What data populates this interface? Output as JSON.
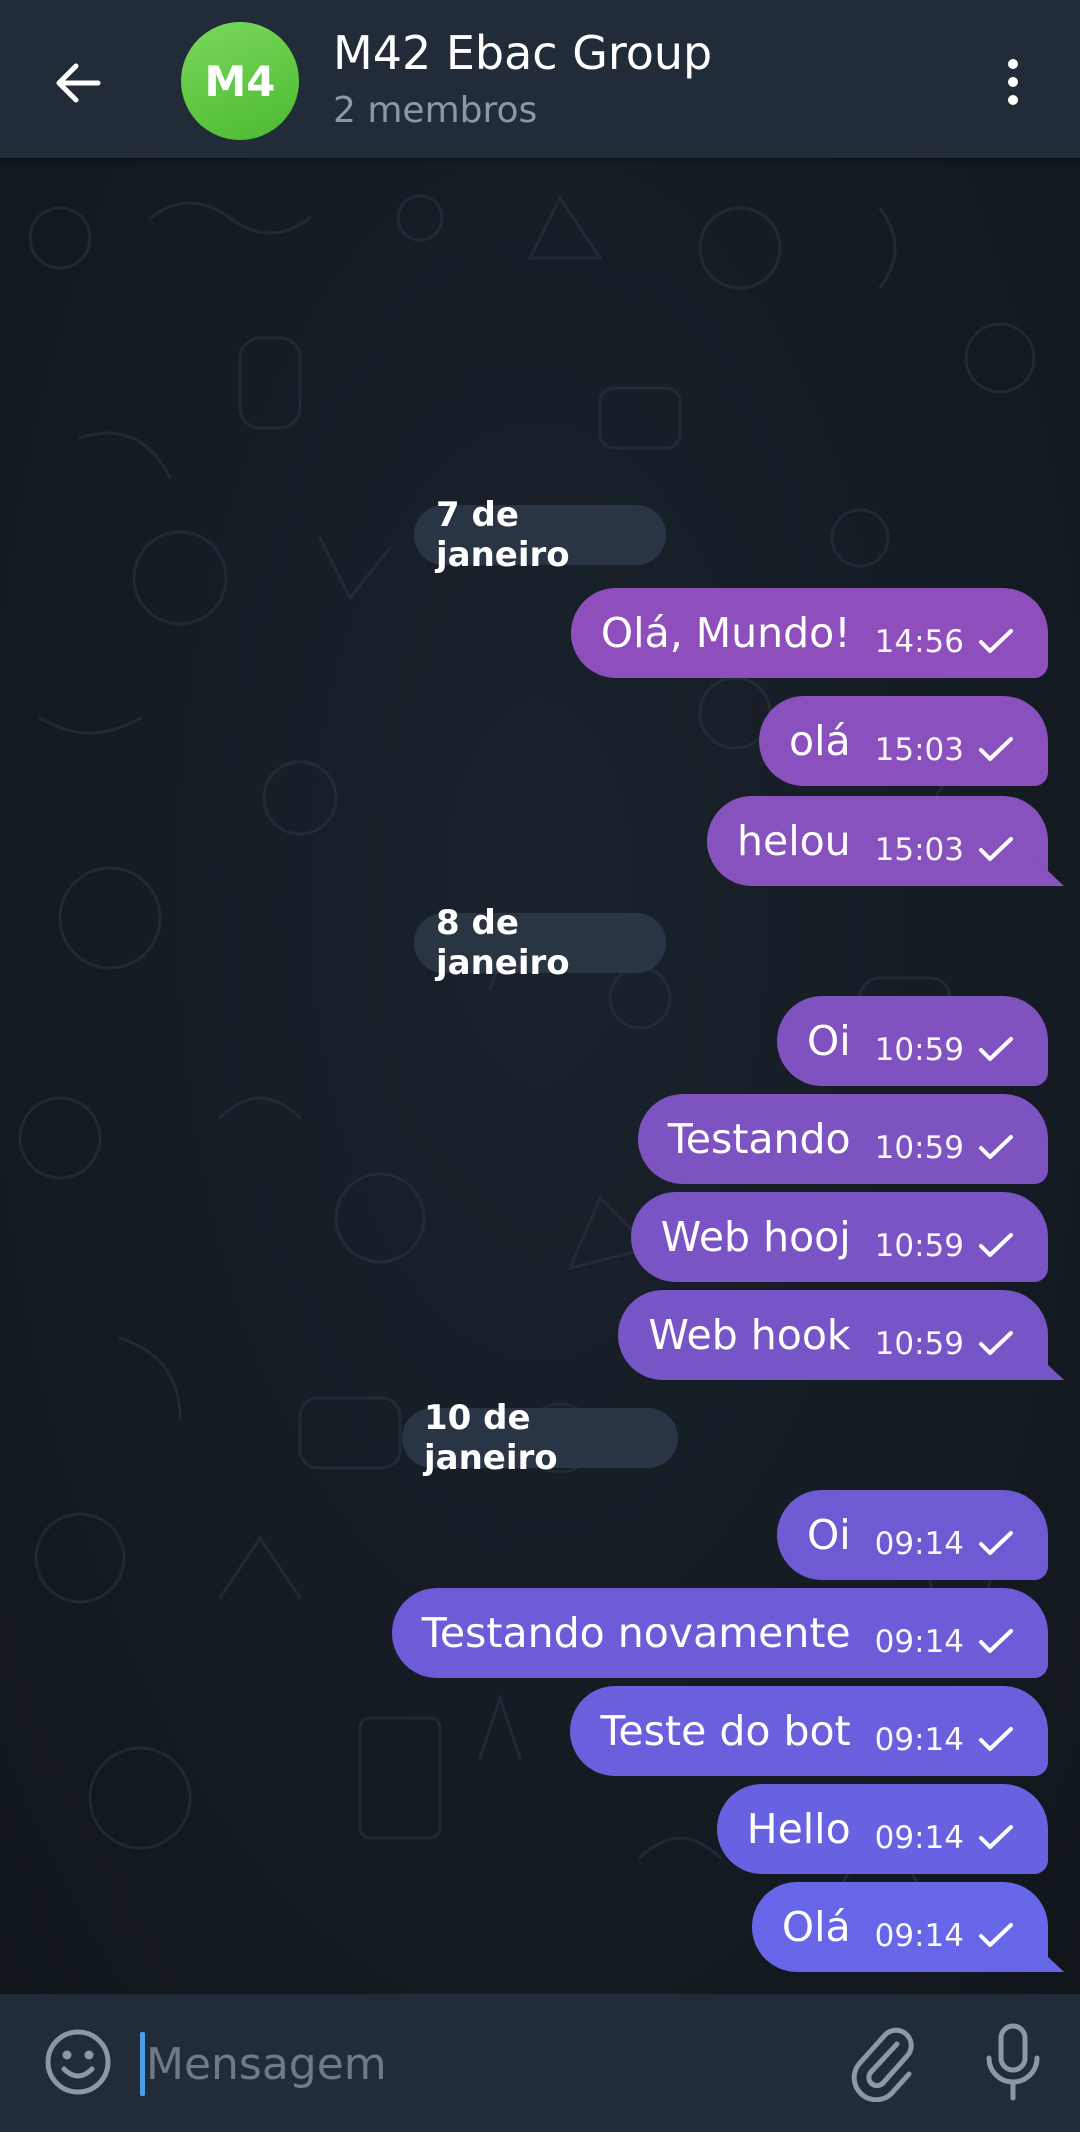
{
  "header": {
    "avatar_initials": "M4",
    "title": "M42 Ebac Group",
    "subtitle": "2 membros",
    "back_icon": "arrow-left-icon",
    "menu_icon": "more-vertical-icon"
  },
  "dates": [
    "7 de janeiro",
    "8 de janeiro",
    "10 de janeiro"
  ],
  "messages": [
    {
      "text": "Olá, Mundo!",
      "time": "14:56"
    },
    {
      "text": "olá",
      "time": "15:03"
    },
    {
      "text": "helou",
      "time": "15:03"
    },
    {
      "text": "Oi",
      "time": "10:59"
    },
    {
      "text": "Testando",
      "time": "10:59"
    },
    {
      "text": "Web hooj",
      "time": "10:59"
    },
    {
      "text": "Web hook",
      "time": "10:59"
    },
    {
      "text": "Oi",
      "time": "09:14"
    },
    {
      "text": "Testando novamente",
      "time": "09:14"
    },
    {
      "text": "Teste do bot",
      "time": "09:14"
    },
    {
      "text": "Hello",
      "time": "09:14"
    },
    {
      "text": "Olá",
      "time": "09:14"
    }
  ],
  "input": {
    "placeholder": "Mensagem",
    "value": ""
  },
  "colors": {
    "header_bg": "#222c38",
    "chat_bg": "#151c24",
    "bubble_top": "#8f4fbb",
    "bubble_bottom": "#6a66e8",
    "avatar_green": "#5cc73c",
    "caret_blue": "#4c9dea"
  }
}
